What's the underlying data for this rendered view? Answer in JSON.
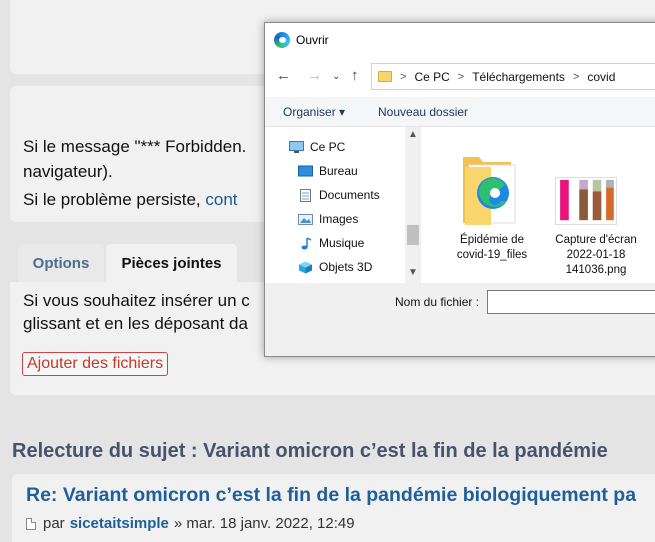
{
  "page": {
    "message": {
      "line1": "Si le message \"*** Forbidden.",
      "line2": "navigateur).",
      "line3_prefix": "Si le problème persiste, ",
      "line3_link": "cont"
    },
    "tabs": {
      "options": "Options",
      "attachments": "Pièces jointes"
    },
    "attachments": {
      "line1": "Si vous souhaitez insérer un c",
      "line2": "glissant et en les déposant da",
      "add_button": "Ajouter des fichiers"
    },
    "review_title": "Relecture du sujet : Variant omicron c’est la fin de la pandémie",
    "post": {
      "title": "Re: Variant omicron c’est la fin de la pandémie biologiquement pa",
      "by": "par",
      "author": "sicetaitsimple",
      "date": "» mar. 18 janv. 2022, 12:49"
    }
  },
  "dialog": {
    "title": "Ouvrir",
    "nav": {
      "back": "←",
      "forward": "→",
      "recent": "⌄",
      "up": "↑"
    },
    "address": [
      "Ce PC",
      "Téléchargements",
      "covid"
    ],
    "address_sep": ">",
    "commands": {
      "organize": "Organiser ▾",
      "new_folder": "Nouveau dossier"
    },
    "nav_items": [
      {
        "label": "Ce PC",
        "icon": "computer-icon"
      },
      {
        "label": "Bureau",
        "icon": "desktop-icon"
      },
      {
        "label": "Documents",
        "icon": "documents-icon"
      },
      {
        "label": "Images",
        "icon": "images-icon"
      },
      {
        "label": "Musique",
        "icon": "music-icon"
      },
      {
        "label": "Objets 3D",
        "icon": "3d-objects-icon"
      }
    ],
    "files": [
      {
        "name": "Épidémie de covid-19_files",
        "line1": "Épidémie de",
        "line2": "covid-19_files",
        "icon": "folder-edge-icon"
      },
      {
        "name": "Capture d'écran 2022-01-18 141036.png",
        "line1": "Capture d'écran",
        "line2": "2022-01-18",
        "line3": "141036.png",
        "icon": "image-thumbnail"
      }
    ],
    "filename_label": "Nom du fichier :",
    "filename_value": ""
  },
  "colors": {
    "accent_link": "#1f5f99",
    "add_button": "#c0392b",
    "folder": "#f9d56e"
  }
}
